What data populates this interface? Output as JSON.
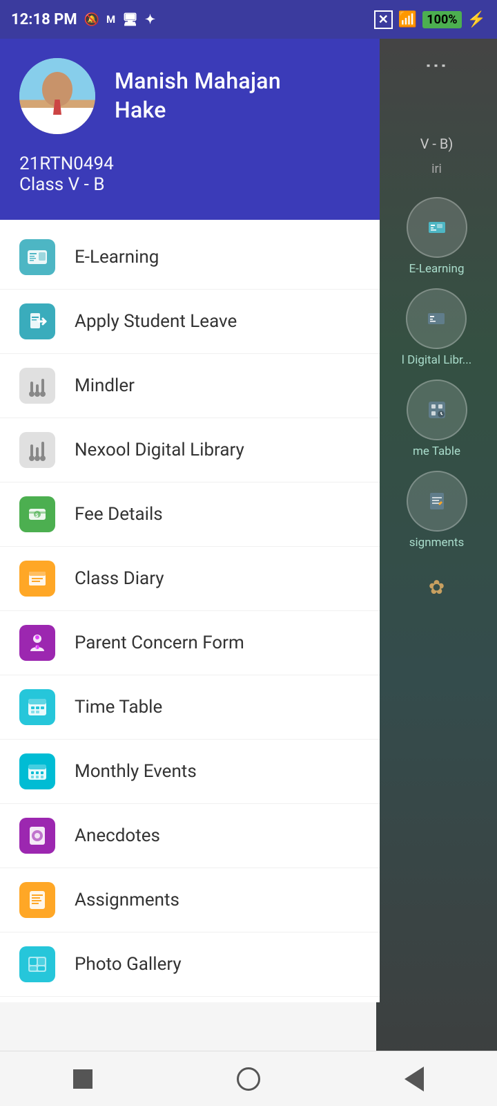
{
  "statusBar": {
    "time": "12:18 PM",
    "battery": "100"
  },
  "profile": {
    "name": "Manish Mahajan\nHake",
    "name_line1": "Manish Mahajan",
    "name_line2": "Hake",
    "id": "21RTN0494",
    "class": "Class V - B"
  },
  "menuItems": [
    {
      "id": "elearning",
      "label": "E-Learning",
      "iconClass": "icon-elearning"
    },
    {
      "id": "leave",
      "label": "Apply Student Leave",
      "iconClass": "icon-leave"
    },
    {
      "id": "mindler",
      "label": "Mindler",
      "iconClass": "icon-mindler"
    },
    {
      "id": "library",
      "label": "Nexool Digital Library",
      "iconClass": "icon-library"
    },
    {
      "id": "fee",
      "label": "Fee Details",
      "iconClass": "icon-fee"
    },
    {
      "id": "diary",
      "label": "Class Diary",
      "iconClass": "icon-diary"
    },
    {
      "id": "parent",
      "label": "Parent Concern Form",
      "iconClass": "icon-parent"
    },
    {
      "id": "timetable",
      "label": "Time Table",
      "iconClass": "icon-timetable"
    },
    {
      "id": "events",
      "label": "Monthly Events",
      "iconClass": "icon-events"
    },
    {
      "id": "anecdotes",
      "label": "Anecdotes",
      "iconClass": "icon-anecdotes"
    },
    {
      "id": "assignments",
      "label": "Assignments",
      "iconClass": "icon-assignments"
    },
    {
      "id": "gallery",
      "label": "Photo Gallery",
      "iconClass": "icon-gallery"
    }
  ],
  "rightPanel": {
    "circleLabels": [
      "E-Learning",
      "l Digital Libr...",
      "me Table",
      "signments"
    ]
  },
  "bottomNav": {
    "stop": "■",
    "home": "○",
    "back": "◄"
  }
}
